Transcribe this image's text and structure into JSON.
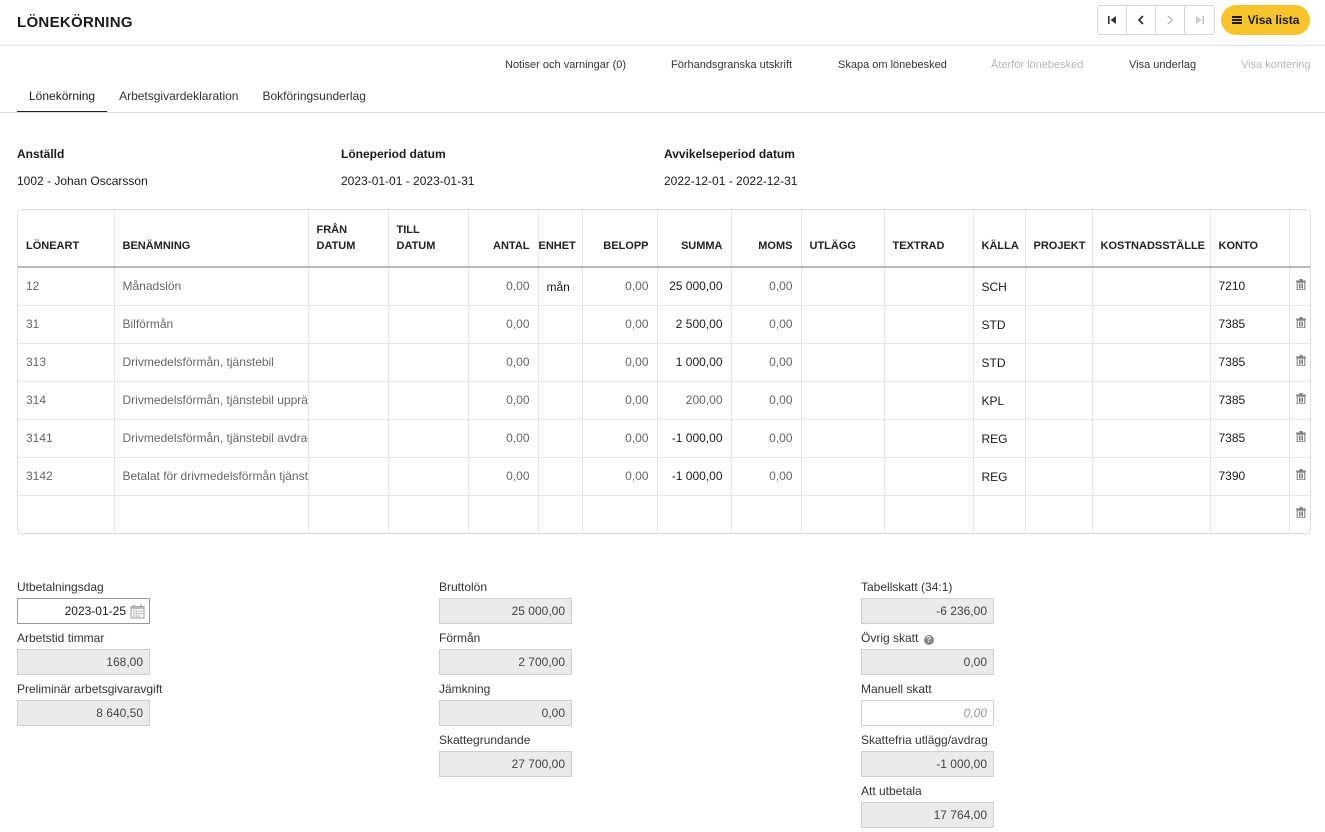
{
  "header": {
    "title": "LÖNEKÖRNING",
    "visa_lista_label": "Visa lista"
  },
  "actions": {
    "notiser": "Notiser och varningar (0)",
    "forhandsgranska": "Förhandsgranska utskrift",
    "skapa_om": "Skapa om lönebesked",
    "aterfor": "Återför lönebesked",
    "visa_underlag": "Visa underlag",
    "visa_kontering": "Visa kontering"
  },
  "tabs": [
    {
      "label": "Lönekörning"
    },
    {
      "label": "Arbetsgivardeklaration"
    },
    {
      "label": "Bokföringsunderlag"
    }
  ],
  "info": {
    "anstalld_label": "Anställd",
    "anstalld_value": "1002 - Johan Oscarsson",
    "period_label": "Löneperiod datum",
    "period_value": "2023-01-01 - 2023-01-31",
    "avvikelse_label": "Avvikelseperiod datum",
    "avvikelse_value": "2022-12-01 - 2022-12-31"
  },
  "table": {
    "headers": {
      "loneart": "LÖNEART",
      "benamning": "BENÄMNING",
      "fran_1": "FRÅN",
      "fran_2": "DATUM",
      "till_1": "TILL",
      "till_2": "DATUM",
      "antal": "ANTAL",
      "enhet": "ENHET",
      "belopp": "BELOPP",
      "summa": "SUMMA",
      "moms": "MOMS",
      "utlagg": "UTLÄGG",
      "textrad": "TEXTRAD",
      "kalla": "KÄLLA",
      "projekt": "PROJEKT",
      "kostnadsstalle": "KOSTNADSSTÄLLE",
      "konto": "KONTO"
    },
    "rows": [
      {
        "loneart": "12",
        "benamning": "Månadslön",
        "antal": "0,00",
        "enhet": "mån",
        "belopp": "0,00",
        "summa": "25 000,00",
        "moms": "0,00",
        "kalla": "SCH",
        "konto": "7210"
      },
      {
        "loneart": "31",
        "benamning": "Bilförmån",
        "antal": "0,00",
        "enhet": "",
        "belopp": "0,00",
        "summa": "2 500,00",
        "moms": "0,00",
        "kalla": "STD",
        "konto": "7385"
      },
      {
        "loneart": "313",
        "benamning": "Drivmedelsförmån, tjänstebil",
        "antal": "0,00",
        "enhet": "",
        "belopp": "0,00",
        "summa": "1 000,00",
        "moms": "0,00",
        "kalla": "STD",
        "konto": "7385"
      },
      {
        "loneart": "314",
        "benamning": "Drivmedelsförmån, tjänstebil uppräkning",
        "antal": "0,00",
        "enhet": "",
        "belopp": "0,00",
        "summa": "200,00",
        "moms": "0,00",
        "kalla": "KPL",
        "konto": "7385"
      },
      {
        "loneart": "3141",
        "benamning": "Drivmedelsförmån, tjänstebil avdrag",
        "antal": "0,00",
        "enhet": "",
        "belopp": "0,00",
        "summa": "-1 000,00",
        "moms": "0,00",
        "kalla": "REG",
        "konto": "7385"
      },
      {
        "loneart": "3142",
        "benamning": "Betalat för drivmedelsförmån tjänstebil",
        "antal": "0,00",
        "enhet": "",
        "belopp": "0,00",
        "summa": "-1 000,00",
        "moms": "0,00",
        "kalla": "REG",
        "konto": "7390"
      }
    ]
  },
  "summary": {
    "utbetalningsdag_label": "Utbetalningsdag",
    "utbetalningsdag_value": "2023-01-25",
    "arbetstid_label": "Arbetstid timmar",
    "arbetstid_value": "168,00",
    "arbetsgivaravgift_label": "Preliminär arbetsgivaravgift",
    "arbetsgivaravgift_value": "8 640,50",
    "bruttolon_label": "Bruttolön",
    "bruttolon_value": "25 000,00",
    "forman_label": "Förmån",
    "forman_value": "2 700,00",
    "jamkning_label": "Jämkning",
    "jamkning_value": "0,00",
    "skattegrundande_label": "Skattegrundande",
    "skattegrundande_value": "27 700,00",
    "tabellskatt_label": "Tabellskatt (34:1)",
    "tabellskatt_value": "-6 236,00",
    "ovrig_skatt_label": "Övrig skatt",
    "ovrig_skatt_value": "0,00",
    "manuell_skatt_label": "Manuell skatt",
    "manuell_skatt_placeholder": "0,00",
    "skattefria_label": "Skattefria utlägg/avdrag",
    "skattefria_value": "-1 000,00",
    "att_utbetala_label": "Att utbetala",
    "att_utbetala_value": "17 764,00"
  },
  "icons": {
    "nav": [
      "first-page-icon",
      "prev-icon",
      "next-icon",
      "last-page-icon"
    ],
    "list": "list-icon",
    "delete": "trash-icon",
    "calendar": "calendar-icon",
    "help": "help-icon"
  },
  "colors": {
    "accent": "#f7c42b"
  }
}
